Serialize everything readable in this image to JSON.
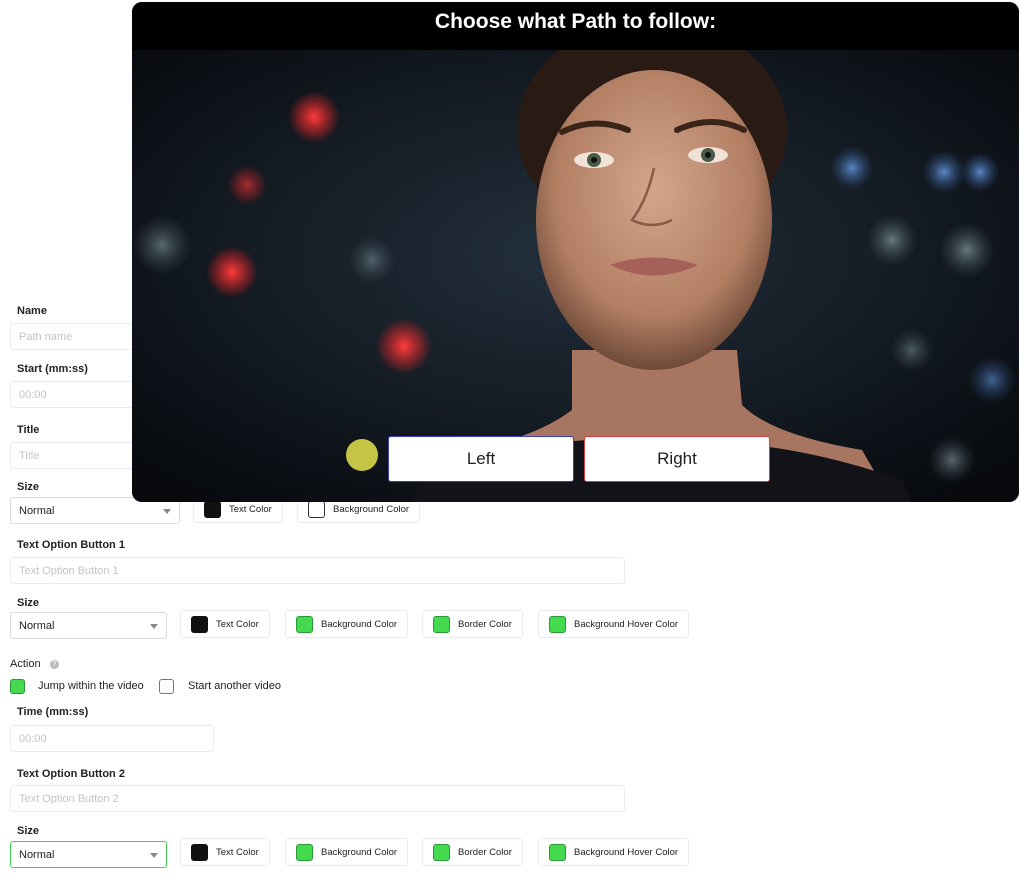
{
  "player": {
    "title": "Choose what Path to follow:",
    "left_button": "Left",
    "right_button": "Right",
    "left_border_color": "#3b41c2",
    "right_border_color": "#d94040"
  },
  "form": {
    "name_label": "Name",
    "name_placeholder": "Path name",
    "start_label": "Start (mm:ss)",
    "start_placeholder": "00:00",
    "title_label": "Title",
    "title_placeholder": "Title",
    "title_size_label": "Size",
    "title_size_value": "Normal",
    "title_text_color": "Text Color",
    "title_bg_color": "Background Color",
    "button1": {
      "label": "Text Option Button 1",
      "placeholder": "Text Option Button 1",
      "size_label": "Size",
      "size_value": "Normal",
      "text_color": "Text Color",
      "bg_color": "Background Color",
      "border_color": "Border Color",
      "bg_hover_color": "Background Hover Color"
    },
    "action": {
      "label": "Action",
      "help_icon": "question-circle-icon",
      "option_jump": "Jump within the video",
      "option_jump_checked": true,
      "option_start": "Start another video",
      "option_start_checked": false
    },
    "time_label": "Time (mm:ss)",
    "time_placeholder": "00:00",
    "button2": {
      "label": "Text Option Button 2",
      "placeholder": "Text Option Button 2",
      "size_label": "Size",
      "size_value": "Normal",
      "text_color": "Text Color",
      "bg_color": "Background Color",
      "border_color": "Border Color",
      "bg_hover_color": "Background Hover Color"
    }
  },
  "colors": {
    "accent_green": "#45d94f",
    "swatch_black": "#111111"
  }
}
